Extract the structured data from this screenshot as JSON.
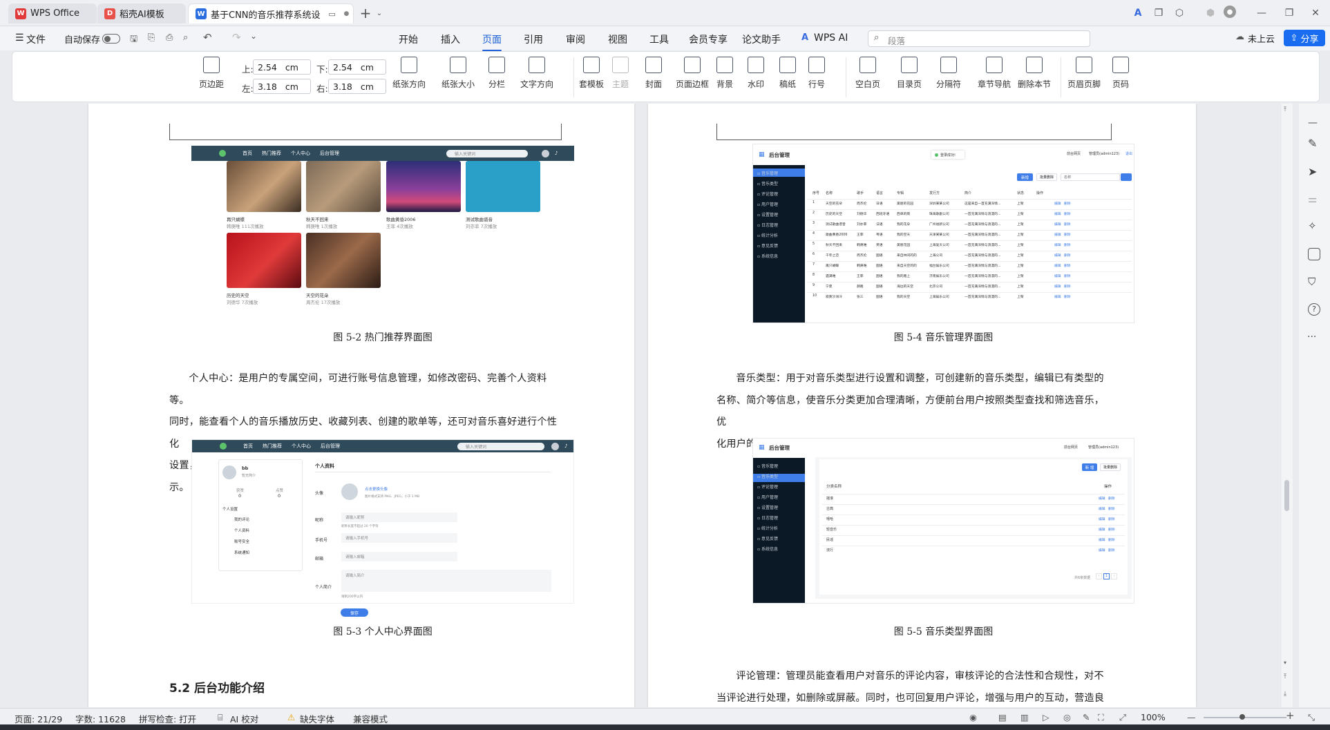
{
  "tabs": [
    {
      "label": "WPS Office",
      "icon": "wps-logo"
    },
    {
      "label": "稻壳AI模板",
      "icon": "docer-logo"
    },
    {
      "label": "基于CNN的音乐推荐系统设",
      "icon": "word-doc-logo"
    }
  ],
  "menu": {
    "file": "文件",
    "autosave": "自动保存",
    "items": [
      "开始",
      "插入",
      "页面",
      "引用",
      "审阅",
      "视图",
      "工具",
      "会员专享",
      "论文助手",
      "WPS AI"
    ],
    "active": "页面",
    "search_placeholder": "段落",
    "not_uploaded": "未上云",
    "share": "分享"
  },
  "ribbon": {
    "margins_label": "页边距",
    "top_label": "上:",
    "top_value": "2.54",
    "bottom_label": "下:",
    "bottom_value": "2.54",
    "left_label": "左:",
    "left_value": "3.18",
    "right_label": "右:",
    "right_value": "3.18",
    "unit": "cm",
    "buttons": [
      "纸张方向",
      "纸张大小",
      "分栏",
      "文字方向",
      "套模板",
      "主题",
      "封面",
      "页面边框",
      "背景",
      "水印",
      "稿纸",
      "行号",
      "空白页",
      "目录页",
      "分隔符",
      "章节导航",
      "删除本节",
      "页眉页脚",
      "页码"
    ]
  },
  "left_page": {
    "shot1": {
      "nav": [
        "首页",
        "热门推荐",
        "个人中心",
        "后台管理"
      ],
      "search": "输入关键词",
      "items": [
        {
          "title": "再只蝴蝶",
          "sub": "韩庚唯 111次播放"
        },
        {
          "title": "秋天不回来",
          "sub": "韩庚唯 1次播放"
        },
        {
          "title": "歌曲黄昏2006",
          "sub": "王菲 4次播放"
        },
        {
          "title": "测试歌曲谱音",
          "sub": "刘亦菲 7次播放"
        },
        {
          "title": "历史的天空",
          "sub": "刘德华 7次播放"
        },
        {
          "title": "天空的花朵",
          "sub": "周杰伦 17次播放"
        }
      ]
    },
    "caption1": "图 5-2 热门推荐界面图",
    "para1_lines": [
      "个人中心：是用户的专属空间，可进行账号信息管理，如修改密码、完善个人资料等。",
      "同时，能查看个人的音乐播放历史、收藏列表、创建的歌单等，还可对音乐喜好进行个性化",
      "设置，系统会依据这些设置优化后续的推荐内容，增强用户的个性化体验，如图 5-3 所示。"
    ],
    "shot2": {
      "nav": [
        "首页",
        "热门推荐",
        "个人中心",
        "后台管理"
      ],
      "search": "输入关键词",
      "username": "bb",
      "user_sub": "暂无简介",
      "stats": [
        {
          "label": "获赞",
          "value": "0"
        },
        {
          "label": "点赞",
          "value": "0"
        }
      ],
      "settings_title": "个人设置",
      "settings": [
        "我的评论",
        "个人资料",
        "账号安全",
        "系统通知"
      ],
      "profile_title": "个人资料",
      "fields": [
        {
          "label": "头像",
          "value": "点击更换头像",
          "hint": "图片格式支持 PNG、JPEG，小于 1 MB"
        },
        {
          "label": "昵称",
          "value": "请输入昵称",
          "hint": "昵称长度不超过 20 个字符"
        },
        {
          "label": "手机号",
          "value": "请输入手机号",
          "hint": ""
        },
        {
          "label": "邮箱",
          "value": "请输入邮箱",
          "hint": ""
        },
        {
          "label": "个人简介",
          "value": "请输入简介",
          "hint": "限制200字以内"
        }
      ],
      "save": "保存"
    },
    "caption2": "图 5-3 个人中心界面图",
    "heading": "5.2 后台功能介绍"
  },
  "right_page": {
    "shot1": {
      "title": "后台管理",
      "toast": "登录成功!",
      "top_links": [
        "前台网页",
        "管理员(admin123)",
        "退出"
      ],
      "side": [
        "音乐管理",
        "音乐类型",
        "评论管理",
        "用户管理",
        "设置管理",
        "日志管理",
        "统计分析",
        "意见反馈",
        "系统信息"
      ],
      "buttons": [
        "新增",
        "批量删除",
        "名称"
      ],
      "columns": [
        "序号",
        "名称",
        "歌手",
        "语言",
        "专辑",
        "发行方",
        "简介",
        "状态",
        "操作"
      ],
      "rows": [
        [
          "1",
          "天空的花朵",
          "周杰伦",
          "日语",
          "美丽的花园",
          "深圳某某公司",
          "这是来自一首充满深情...",
          "上架"
        ],
        [
          "2",
          "历史的天空",
          "刘德华",
          "西班牙语",
          "西单的雨",
          "珠海歌剧公司",
          "一首充满深情与浪漫的...",
          "上架"
        ],
        [
          "3",
          "测试歌曲谱音",
          "刘亦菲",
          "法语",
          "我的花朵",
          "广州福新公司",
          "一首充满深情与浪漫的...",
          "上架"
        ],
        [
          "4",
          "歌曲黄昏2006",
          "王菲",
          "粤语",
          "我的空天",
          "天津某某公司",
          "一首充满深情与浪漫的...",
          "上架"
        ],
        [
          "5",
          "秋天不回来",
          "韩庚唯",
          "英语",
          "美丽花园",
          "上海复天公司",
          "一首充满深情与浪漫的...",
          "上架"
        ],
        [
          "6",
          "千年之恋",
          "周杰伦",
          "国语",
          "来自林间的的",
          "上海公司",
          "一首充满深情与浪漫的...",
          "上架"
        ],
        [
          "7",
          "再只蝴蝶",
          "韩庚唯",
          "国语",
          "来自天空的的",
          "福台娱乐公司",
          "一首充满深情与浪漫的...",
          "上架"
        ],
        [
          "8",
          "遇满唯",
          "王菲",
          "国语",
          "我的路上",
          "济南娱乐公司",
          "一首充满深情与浪漫的...",
          "上架"
        ],
        [
          "9",
          "宁夏",
          "薛路",
          "国语",
          "海边的天空",
          "北京公司",
          "一首充满深情与浪漫的...",
          "上架"
        ],
        [
          "10",
          "寂寞沙洲冷",
          "张三",
          "国语",
          "我的天空",
          "上海娱乐公司",
          "一首充满深情与浪漫的...",
          "上架"
        ]
      ],
      "actions": [
        "编辑",
        "删除"
      ]
    },
    "caption1": "图 5-4 音乐管理界面图",
    "para1_lines": [
      "音乐类型：用于对音乐类型进行设置和调整，可创建新的音乐类型，编辑已有类型的",
      "名称、简介等信息，使音乐分类更加合理清晰，方便前台用户按照类型查找和筛选音乐，优",
      "化用户的音乐检索体验，如图 5-5 所示。"
    ],
    "shot2": {
      "title": "后台管理",
      "top_links": [
        "前台网页",
        "管理员(admin123)"
      ],
      "side": [
        "音乐管理",
        "音乐类型",
        "评论管理",
        "用户管理",
        "设置管理",
        "日志管理",
        "统计分析",
        "意见反馈",
        "系统信息"
      ],
      "buttons": [
        "新 增",
        "批量删除"
      ],
      "column": "分类名称",
      "action_col": "操作",
      "rows": [
        "摇滚",
        "古典",
        "嘻哈",
        "轻音乐",
        "民谣",
        "流行"
      ],
      "actions": [
        "编辑",
        "删除"
      ],
      "pager": "共6条数据",
      "page": "1"
    },
    "caption2": "图 5-5 音乐类型界面图",
    "para2_lines": [
      "评论管理：管理员能查看用户对音乐的评论内容，审核评论的合法性和合规性，对不",
      "当评论进行处理，如删除或屏蔽。同时，也可回复用户评论，增强与用户的互动，营造良好"
    ]
  },
  "status": {
    "page": "页面: 21/29",
    "words": "字数: 11628",
    "spell": "拼写检查: 打开",
    "ai_check": "AI 校对",
    "missing_font": "缺失字体",
    "compat": "兼容模式",
    "zoom": "100%"
  },
  "colors": {
    "accent": "#1a5fd6",
    "admin_sidebar": "#0b1825",
    "admin_blue": "#3f7ee8",
    "nav": "#2f4a5a"
  }
}
